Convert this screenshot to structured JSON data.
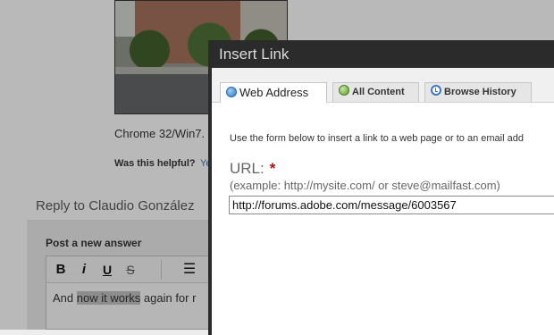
{
  "page": {
    "caption": "Chrome 32/Win7.",
    "helpful_question": "Was this helpful?",
    "helpful_yes": "Ye",
    "reply_heading": "Reply to Claudio González",
    "post_answer_label": "Post a new answer",
    "toolbar": {
      "bold": "B",
      "italic": "i",
      "underline": "U",
      "strike": "S",
      "list": "☰"
    },
    "editor_text_before": "And ",
    "editor_text_highlight": "now it works",
    "editor_text_after": " again for r"
  },
  "dialog": {
    "title": "Insert Link",
    "tabs": [
      {
        "label": "Web Address",
        "icon": "globe-icon",
        "active": true
      },
      {
        "label": "All Content",
        "icon": "all-content-icon",
        "active": false
      },
      {
        "label": "Browse History",
        "icon": "history-icon",
        "active": false
      }
    ],
    "instructions": "Use the form below to insert a link to a web page or to an email add",
    "url_label": "URL:",
    "required_mark": "*",
    "example": "(example: http://mysite.com/ or steve@mailfast.com)",
    "url_value": "http://forums.adobe.com/message/6003567"
  }
}
